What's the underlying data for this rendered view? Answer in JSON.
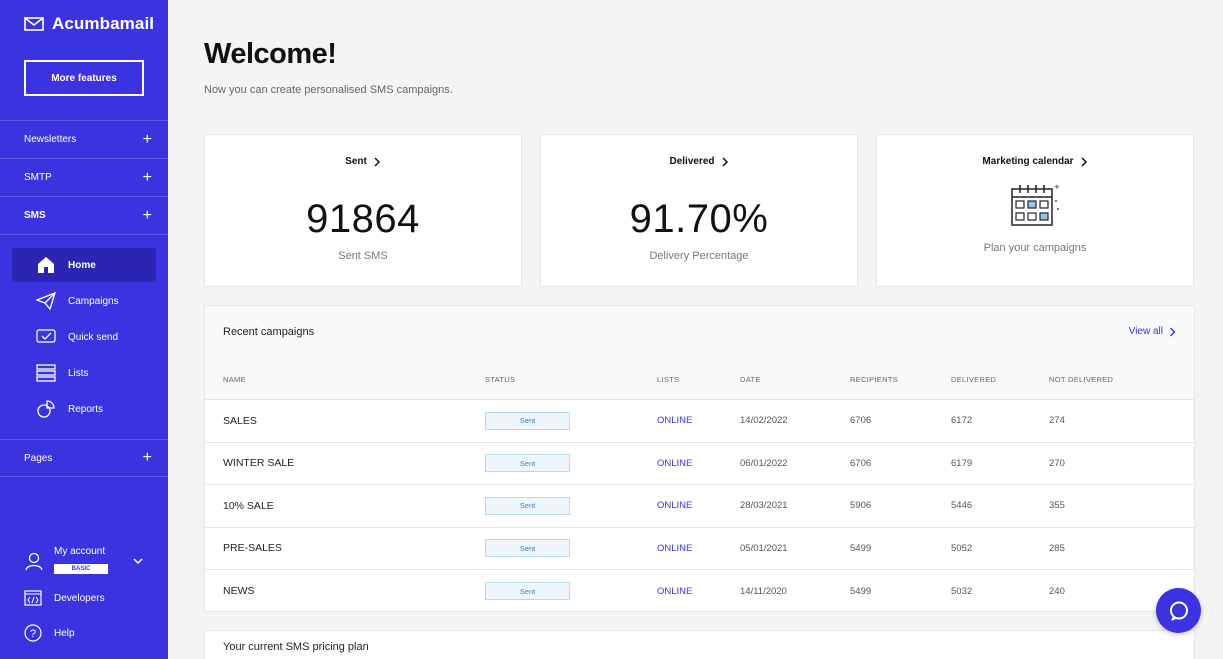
{
  "sidebar": {
    "brand": "Acumbamail",
    "more_features": "More features",
    "sections": [
      {
        "label": "Newsletters"
      },
      {
        "label": "SMTP"
      },
      {
        "label": "SMS"
      },
      {
        "label": "Pages"
      }
    ],
    "nav": [
      {
        "label": "Home",
        "icon": "home-icon"
      },
      {
        "label": "Campaigns",
        "icon": "paper-plane-icon"
      },
      {
        "label": "Quick send",
        "icon": "quick-send-icon"
      },
      {
        "label": "Lists",
        "icon": "list-icon"
      },
      {
        "label": "Reports",
        "icon": "reports-icon"
      }
    ],
    "account": {
      "label": "My account",
      "badge": "BASIC"
    },
    "developers": "Developers",
    "help": "Help"
  },
  "main": {
    "title": "Welcome!",
    "subtitle": "Now you can create personalised SMS campaigns.",
    "cards": [
      {
        "title": "Sent",
        "value": "91864",
        "label": "Sent SMS"
      },
      {
        "title": "Delivered",
        "value": "91.70%",
        "label": "Delivery Percentage"
      },
      {
        "title": "Marketing calendar",
        "label": "Plan your campaigns"
      }
    ],
    "recent": {
      "title": "Recent campaigns",
      "view_all": "View all",
      "columns": [
        "NAME",
        "STATUS",
        "LISTS",
        "DATE",
        "RECIPIENTS",
        "DELIVERED",
        "NOT DELIVERED"
      ],
      "rows": [
        {
          "name": "SALES",
          "status": "Sent",
          "list": "ONLINE",
          "date": "14/02/2022",
          "recipients": "6706",
          "delivered": "6172",
          "not_delivered": "274"
        },
        {
          "name": "WINTER SALE",
          "status": "Sent",
          "list": "ONLINE",
          "date": "06/01/2022",
          "recipients": "6706",
          "delivered": "6179",
          "not_delivered": "270"
        },
        {
          "name": "10% SALE",
          "status": "Sent",
          "list": "ONLINE",
          "date": "28/03/2021",
          "recipients": "5906",
          "delivered": "5446",
          "not_delivered": "355"
        },
        {
          "name": "PRE-SALES",
          "status": "Sent",
          "list": "ONLINE",
          "date": "05/01/2021",
          "recipients": "5499",
          "delivered": "5052",
          "not_delivered": "285"
        },
        {
          "name": "NEWS",
          "status": "Sent",
          "list": "ONLINE",
          "date": "14/11/2020",
          "recipients": "5499",
          "delivered": "5032",
          "not_delivered": "240"
        }
      ]
    },
    "pricing_title": "Your current SMS pricing plan"
  },
  "colors": {
    "accent": "#3b33e0",
    "active_nav": "#2c25b4"
  }
}
